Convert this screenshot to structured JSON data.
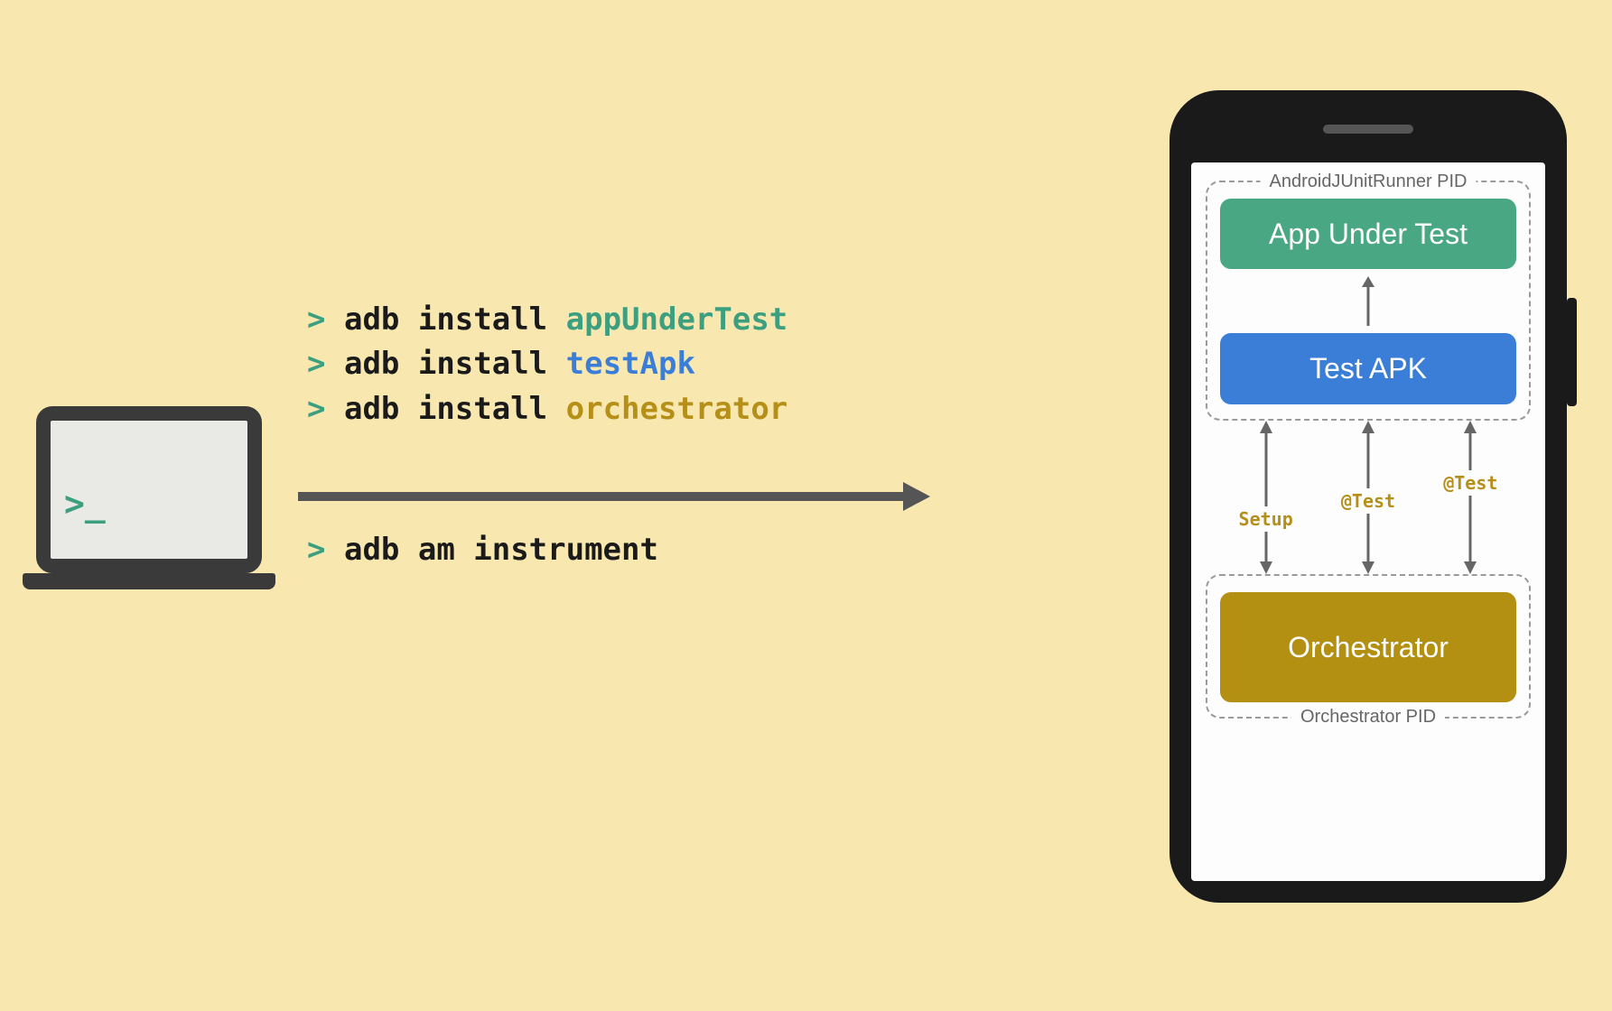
{
  "laptop": {
    "prompt": ">_"
  },
  "commands": {
    "line1": {
      "prompt": ">",
      "cmd": "adb install",
      "target": "appUnderTest"
    },
    "line2": {
      "prompt": ">",
      "cmd": "adb install",
      "target": "testApk"
    },
    "line3": {
      "prompt": ">",
      "cmd": "adb install",
      "target": "orchestrator"
    },
    "line4": {
      "prompt": ">",
      "cmd": "adb am instrument"
    }
  },
  "phone": {
    "runner_pid_label": "AndroidJUnitRunner PID",
    "orchestrator_pid_label": "Orchestrator PID",
    "app_under_test": "App Under Test",
    "test_apk": "Test APK",
    "orchestrator": "Orchestrator",
    "arrows": {
      "setup": "Setup",
      "test1": "@Test",
      "test2": "@Test"
    }
  }
}
